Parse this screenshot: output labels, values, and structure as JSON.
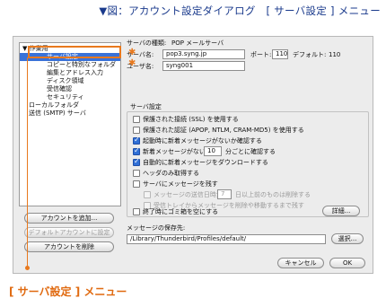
{
  "caption": {
    "top": "▼図：アカウント設定ダイアログ　[ サーバ設定 ] メニュー",
    "bottom": "[ サーバ設定 ] メニュー"
  },
  "sidebar": {
    "items": [
      {
        "label": "▼ 作業用",
        "level": 0
      },
      {
        "label": "サーバ設定",
        "level": 2,
        "selected": true
      },
      {
        "label": "コピーと特別なフォルダ",
        "level": 2
      },
      {
        "label": "編集とアドレス入力",
        "level": 2
      },
      {
        "label": "ディスク領域",
        "level": 2
      },
      {
        "label": "受信確認",
        "level": 2
      },
      {
        "label": "セキュリティ",
        "level": 2
      },
      {
        "label": "ローカルフォルダ",
        "level": 1
      },
      {
        "label": "送信 (SMTP) サーバ",
        "level": 1
      }
    ],
    "buttons": {
      "add_account": "アカウントを追加...",
      "set_default": "デフォルトアカウントに設定",
      "delete_account": "アカウントを削除"
    }
  },
  "server": {
    "type_label": "サーバの種類:",
    "type_value": "POP メールサーバ",
    "name_label": "サーバ名:",
    "name_value": "pop3.syng.jp",
    "port_label": "ポート:",
    "port_value": "110",
    "default_label": "デフォルト:",
    "default_value": "110",
    "user_label": "ユーザ名:",
    "user_value": "syng001"
  },
  "settings": {
    "title": "サーバ設定",
    "options": [
      {
        "label": "保護された接続 (SSL) を使用する",
        "checked": false,
        "dim": false
      },
      {
        "label": "保護された認証 (APOP, NTLM, CRAM-MD5) を使用する",
        "checked": false,
        "dim": false
      },
      {
        "label": "起動時に新着メッセージがないか確認する",
        "checked": true,
        "dim": false
      },
      {
        "label": "新着メッセージがないか",
        "suffix": "分ごとに確認する",
        "value": "10",
        "checked": true,
        "dim": false
      },
      {
        "label": "自動的に新着メッセージをダウンロードする",
        "checked": true,
        "dim": false
      },
      {
        "label": "ヘッダのみ取得する",
        "checked": false,
        "dim": false
      },
      {
        "label": "サーバにメッセージを残す",
        "checked": false,
        "dim": false
      },
      {
        "label": "メッセージの送信日時が",
        "suffix": "日以上前のものは削除する",
        "value": "7",
        "checked": false,
        "dim": true
      },
      {
        "label": "受信トレイからメッセージを削除や移動するまで残す",
        "checked": false,
        "dim": true
      },
      {
        "label": "終了時にゴミ箱を空にする",
        "checked": false,
        "dim": false
      }
    ],
    "advanced_button": "詳細..."
  },
  "storage": {
    "label": "メッセージの保存先:",
    "path": "/Library/Thunderbird/Profiles/default/",
    "browse_button": "選択..."
  },
  "footer": {
    "cancel": "キャンセル",
    "ok": "OK"
  },
  "colors": {
    "accent": "#e8791e",
    "selection": "#3a72d8",
    "caption": "#1a3a8c"
  }
}
